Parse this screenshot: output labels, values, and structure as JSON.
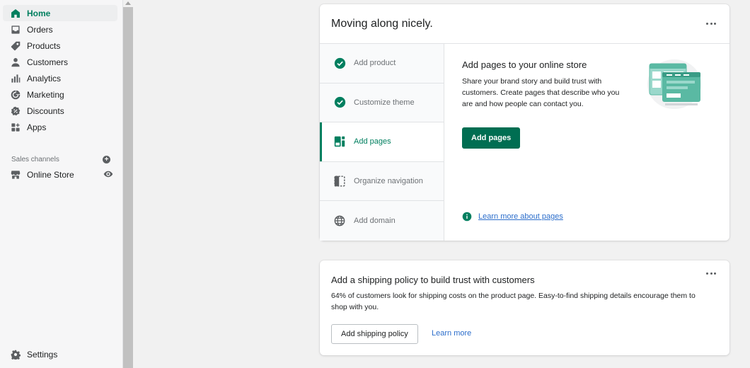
{
  "sidebar": {
    "items": [
      {
        "label": "Home",
        "icon": "home-icon"
      },
      {
        "label": "Orders",
        "icon": "orders-icon"
      },
      {
        "label": "Products",
        "icon": "tag-icon"
      },
      {
        "label": "Customers",
        "icon": "person-icon"
      },
      {
        "label": "Analytics",
        "icon": "bar-chart-icon"
      },
      {
        "label": "Marketing",
        "icon": "marketing-icon"
      },
      {
        "label": "Discounts",
        "icon": "discount-icon"
      },
      {
        "label": "Apps",
        "icon": "apps-icon"
      }
    ],
    "sales_channels_label": "Sales channels",
    "online_store_label": "Online Store",
    "settings_label": "Settings"
  },
  "setup_card": {
    "title": "Moving along nicely.",
    "steps": [
      {
        "label": "Add product",
        "state": "completed"
      },
      {
        "label": "Customize theme",
        "state": "completed"
      },
      {
        "label": "Add pages",
        "state": "active"
      },
      {
        "label": "Organize navigation",
        "state": "pending"
      },
      {
        "label": "Add domain",
        "state": "pending"
      }
    ],
    "detail": {
      "title": "Add pages to your online store",
      "description": "Share your brand story and build trust with customers. Create pages that describe who you are and how people can contact you.",
      "button_label": "Add pages",
      "learn_more_label": "Learn more about pages"
    }
  },
  "shipping_card": {
    "title": "Add a shipping policy to build trust with customers",
    "description": "64% of customers look for shipping costs on the product page. Easy-to-find shipping details encourage them to shop with you.",
    "button_label": "Add shipping policy",
    "learn_more_label": "Learn more"
  },
  "colors": {
    "brand_green": "#008060",
    "primary_button": "#006e52",
    "link_blue": "#2c6ecb"
  }
}
